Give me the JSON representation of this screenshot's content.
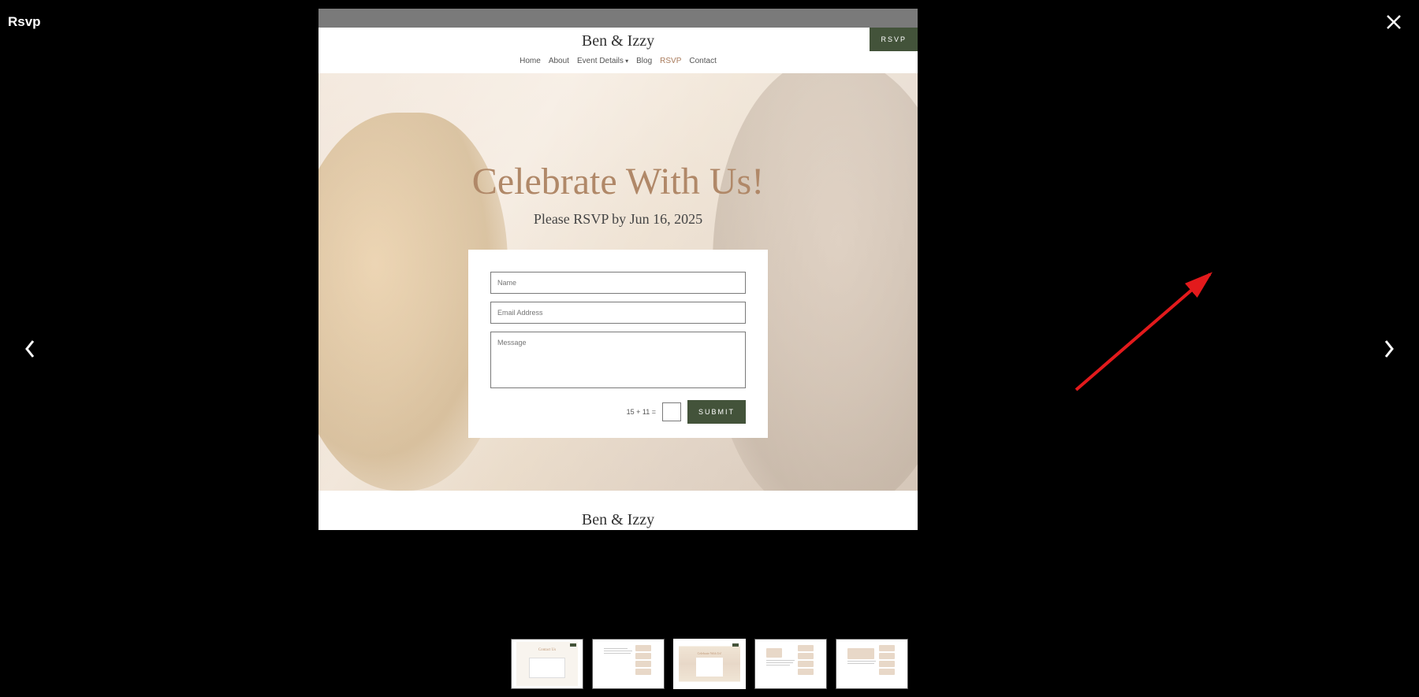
{
  "lightbox": {
    "title": "Rsvp"
  },
  "page": {
    "site_title": "Ben & Izzy",
    "nav": [
      {
        "label": "Home",
        "active": false,
        "dropdown": false
      },
      {
        "label": "About",
        "active": false,
        "dropdown": false
      },
      {
        "label": "Event Details",
        "active": false,
        "dropdown": true
      },
      {
        "label": "Blog",
        "active": false,
        "dropdown": false
      },
      {
        "label": "RSVP",
        "active": true,
        "dropdown": false
      },
      {
        "label": "Contact",
        "active": false,
        "dropdown": false
      }
    ],
    "rsvp_button": "RSVP",
    "hero": {
      "title": "Celebrate With Us!",
      "subtitle": "Please RSVP by Jun 16, 2025"
    },
    "form": {
      "name_placeholder": "Name",
      "email_placeholder": "Email Address",
      "message_placeholder": "Message",
      "captcha": "15 + 11 =",
      "submit": "SUBMIT"
    }
  },
  "thumbnails": [
    {
      "type": "contact",
      "active": false
    },
    {
      "type": "sidebar-dark",
      "active": false
    },
    {
      "type": "rsvp",
      "active": true
    },
    {
      "type": "sidebar-light",
      "active": false
    },
    {
      "type": "sidebar-light2",
      "active": false
    }
  ]
}
